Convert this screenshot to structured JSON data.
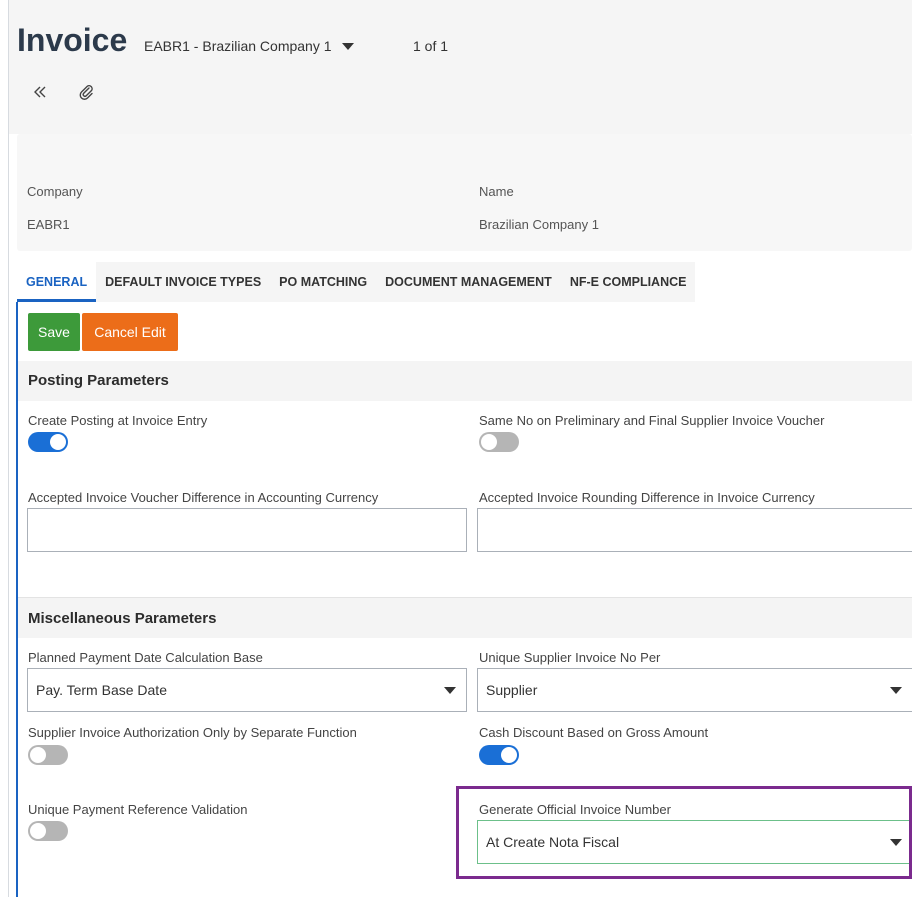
{
  "header": {
    "title": "Invoice",
    "company_selector": "EABR1 - Brazilian Company 1",
    "pager": "1 of 1"
  },
  "icons": {
    "collapse": "double-chevron-left-icon",
    "attachment": "paperclip-icon"
  },
  "summary": {
    "company_label": "Company",
    "company_value": "EABR1",
    "name_label": "Name",
    "name_value": "Brazilian Company 1"
  },
  "tabs": [
    {
      "label": "GENERAL",
      "active": true
    },
    {
      "label": "DEFAULT INVOICE TYPES",
      "active": false
    },
    {
      "label": "PO MATCHING",
      "active": false
    },
    {
      "label": "DOCUMENT MANAGEMENT",
      "active": false
    },
    {
      "label": "NF-E COMPLIANCE",
      "active": false
    }
  ],
  "actions": {
    "save": "Save",
    "cancel": "Cancel Edit"
  },
  "posting": {
    "title": "Posting Parameters",
    "create_posting_label": "Create Posting at Invoice Entry",
    "create_posting_on": true,
    "same_no_label": "Same No on Preliminary and Final Supplier Invoice Voucher",
    "same_no_on": false,
    "voucher_diff_label": "Accepted Invoice Voucher Difference in Accounting Currency",
    "voucher_diff_value": "",
    "rounding_diff_label": "Accepted Invoice Rounding Difference in Invoice Currency",
    "rounding_diff_value": ""
  },
  "misc": {
    "title": "Miscellaneous Parameters",
    "planned_payment_label": "Planned Payment Date Calculation Base",
    "planned_payment_value": "Pay. Term Base Date",
    "unique_supplier_label": "Unique Supplier Invoice No Per",
    "unique_supplier_value": "Supplier",
    "auth_separate_label": "Supplier Invoice Authorization Only by Separate Function",
    "auth_separate_on": false,
    "cash_discount_label": "Cash Discount Based on Gross Amount",
    "cash_discount_on": true,
    "unique_payment_label": "Unique Payment Reference Validation",
    "unique_payment_on": false,
    "generate_official_label": "Generate Official Invoice Number",
    "generate_official_value": "At Create Nota Fiscal"
  },
  "colors": {
    "accent": "#1a63c2",
    "save": "#3d9a3a",
    "cancel": "#ec6d19",
    "highlight": "#7b2a8e"
  }
}
